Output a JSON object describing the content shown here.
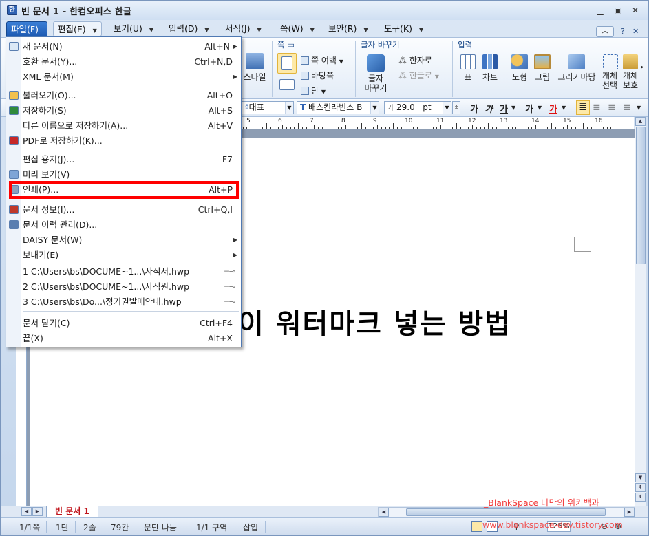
{
  "window": {
    "title": "빈 문서 1 - 한컴오피스 한글",
    "controls": [
      "minimize-icon",
      "restore-icon",
      "close-icon"
    ]
  },
  "menubar": {
    "items": [
      {
        "label": "파일(F)",
        "active": true
      },
      {
        "label": "편집(E)"
      },
      {
        "label": "보기(U)"
      },
      {
        "label": "입력(D)"
      },
      {
        "label": "서식(J)"
      },
      {
        "label": "쪽(W)"
      },
      {
        "label": "보안(R)"
      },
      {
        "label": "도구(K)"
      }
    ],
    "help": "?",
    "collapse": "︿"
  },
  "ribbon": {
    "style_label": "스타일",
    "page_group": {
      "title": "쪽",
      "margin": "쪽 여백",
      "background": "바탕쪽",
      "columns": "단"
    },
    "char_group": {
      "title": "글자 바꾸기",
      "change": "글자 바꾸기",
      "hanja": "한자로",
      "hangul": "한글로"
    },
    "insert_group": {
      "title": "입력",
      "items": [
        "표",
        "차트",
        "도형",
        "그림",
        "그리기마당",
        "개체 선택",
        "개체 보호"
      ]
    }
  },
  "format_bar": {
    "style": "대표",
    "font": "배스킨라빈스 B",
    "size": "29.0",
    "unit": "pt",
    "bold": "가",
    "italic": "가",
    "underline": "가",
    "strike": "가",
    "color": "가"
  },
  "ruler": {
    "numbers": [
      "5",
      "6",
      "7",
      "8",
      "9",
      "10",
      "11",
      "12",
      "13",
      "14",
      "15",
      "16"
    ]
  },
  "document": {
    "heading": "이 워터마크 넣는 방법"
  },
  "file_menu": {
    "items": [
      {
        "label": "새 문서(N)",
        "shortcut": "Alt+N",
        "submenu": true,
        "icon": "new-doc-icon"
      },
      {
        "label": "호환 문서(Y)...",
        "shortcut": "Ctrl+N,D"
      },
      {
        "label": "XML 문서(M)",
        "submenu": true
      },
      {
        "label": "불러오기(O)...",
        "shortcut": "Alt+O",
        "icon": "folder-open-icon"
      },
      {
        "label": "저장하기(S)",
        "shortcut": "Alt+S",
        "icon": "save-icon"
      },
      {
        "label": "다른 이름으로 저장하기(A)...",
        "shortcut": "Alt+V"
      },
      {
        "label": "PDF로 저장하기(K)...",
        "icon": "pdf-icon"
      },
      {
        "label": "편집 용지(J)...",
        "shortcut": "F7"
      },
      {
        "label": "미리 보기(V)",
        "icon": "preview-icon"
      },
      {
        "label": "인쇄(P)...",
        "shortcut": "Alt+P",
        "icon": "print-icon",
        "highlighted": true
      },
      {
        "label": "문서 정보(I)...",
        "shortcut": "Ctrl+Q,I",
        "icon": "doc-info-icon"
      },
      {
        "label": "문서 이력 관리(D)...",
        "icon": "history-icon"
      },
      {
        "label": "DAISY 문서(W)",
        "submenu": true
      },
      {
        "label": "보내기(E)",
        "submenu": true
      },
      {
        "label": "1 C:\\Users\\bs\\DOCUME~1...\\사직서.hwp",
        "pin": true
      },
      {
        "label": "2 C:\\Users\\bs\\DOCUME~1...\\사직원.hwp",
        "pin": true
      },
      {
        "label": "3 C:\\Users\\bs\\Do...\\정기권발매안내.hwp",
        "pin": true
      },
      {
        "label": "문서 닫기(C)",
        "shortcut": "Ctrl+F4"
      },
      {
        "label": "끝(X)",
        "shortcut": "Alt+X"
      }
    ]
  },
  "tabs": {
    "doc_tab": "빈 문서 1"
  },
  "status": {
    "page": "1/1쪽",
    "column": "1단",
    "line": "2줄",
    "char": "79칸",
    "paragraph": "문단 나눔",
    "section": "1/1 구역",
    "mode": "삽입",
    "zoom": "125%"
  },
  "watermark": {
    "line1": "_BlankSpace 나만의 위키백과",
    "line2": "www.blankspace-dev.tistory.com"
  },
  "colors": {
    "accent": "#1f5cb4",
    "highlight": "#ff0000",
    "watermark": "#f23a3a"
  }
}
